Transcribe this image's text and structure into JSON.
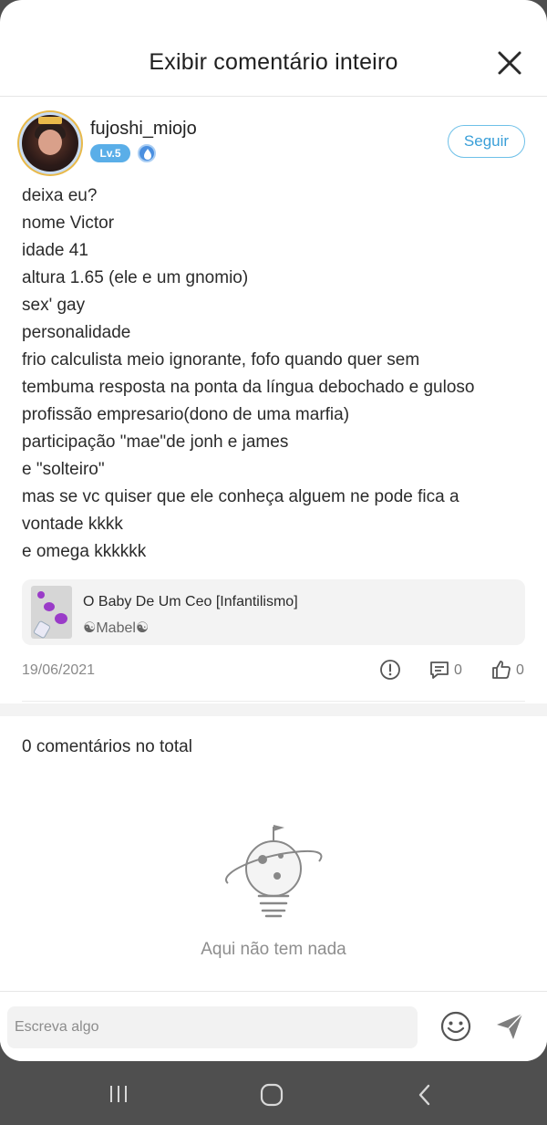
{
  "header": {
    "title": "Exibir comentário inteiro",
    "close_icon": "close-icon"
  },
  "author": {
    "username": "fujoshi_miojo",
    "level": "Lv.5",
    "follow_label": "Seguir"
  },
  "comment": {
    "lines": [
      "deixa eu?",
      "nome Victor",
      "idade 41",
      "altura 1.65 (ele e um gnomio)",
      "sex' gay",
      "personalidade",
      "frio calculista meio ignorante, fofo quando quer sem",
      "tembuma resposta na ponta da língua debochado e guloso",
      "profissão empresario(dono de uma marfia)",
      "participação \"mae\"de jonh e james",
      "e \"solteiro\"",
      "mas se vc quiser que ele conheça alguem ne pode fica a",
      "vontade kkkk",
      "e omega kkkkkk"
    ]
  },
  "linked_post": {
    "title": "O Baby De Um Ceo [Infantilismo]",
    "author": "☯Mabel☯"
  },
  "meta": {
    "date": "19/06/2021",
    "reply_count": "0",
    "like_count": "0"
  },
  "comments": {
    "total_label": "0 comentários no total",
    "empty_label": "Aqui não tem nada"
  },
  "composer": {
    "placeholder": "Escreva algo"
  },
  "colors": {
    "accent": "#3a9fd8",
    "level_badge": "#5aaee8"
  }
}
